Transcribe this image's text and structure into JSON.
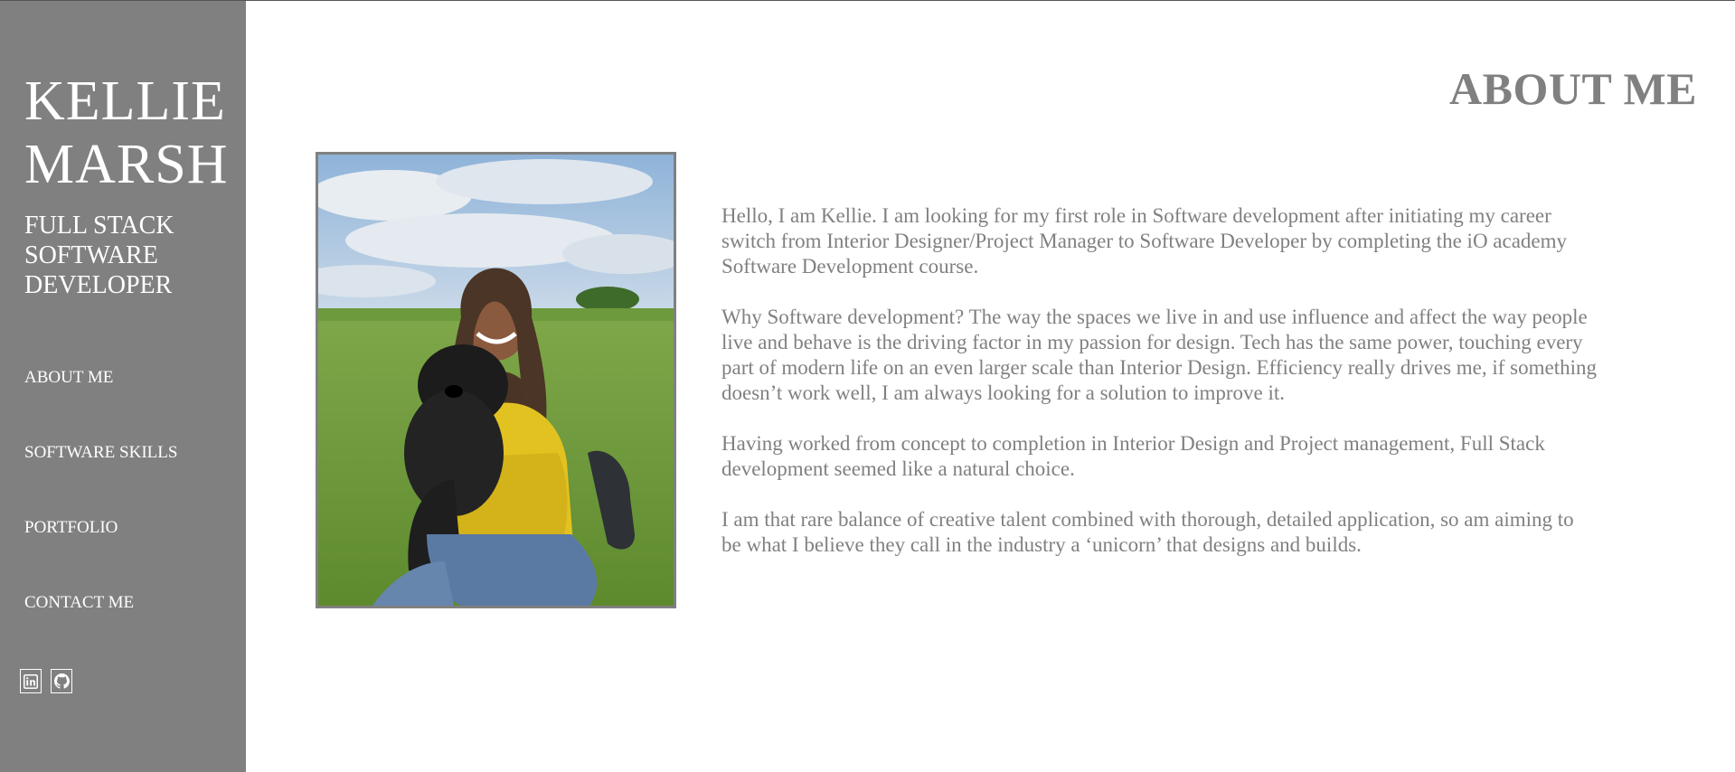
{
  "sidebar": {
    "name_line1": "KELLIE",
    "name_line2": "MARSH",
    "role_line1": "FULL STACK",
    "role_line2": "SOFTWARE",
    "role_line3": "DEVELOPER",
    "nav": [
      {
        "label": "ABOUT ME"
      },
      {
        "label": "SOFTWARE SKILLS"
      },
      {
        "label": "PORTFOLIO"
      },
      {
        "label": "CONTACT ME"
      }
    ],
    "social_icons": [
      "linkedin-icon",
      "github-icon"
    ]
  },
  "main": {
    "title": "ABOUT ME",
    "paragraphs": [
      "Hello, I am Kellie. I am looking for my first role in Software development after initiating my career switch from Interior Designer/Project Manager to Software Developer by completing the iO academy Software Development course.",
      "Why Software development? The way the spaces we live in and use influence and affect the way people live and behave is the driving factor in my passion for design. Tech has the same power, touching every part of modern life on an even larger scale than Interior Design. Efficiency really drives me, if something doesn’t work well, I am always looking for a solution to improve it.",
      "Having worked from concept to completion in Interior Design and Project management, Full Stack development seemed like a natural choice.",
      "I am that rare balance of creative talent combined with thorough, detailed application, so am aiming to be what I believe they call in the industry a ‘unicorn’ that designs and builds."
    ]
  },
  "colors": {
    "sidebar_bg": "#808080",
    "text_grey": "#808080",
    "white": "#ffffff"
  }
}
